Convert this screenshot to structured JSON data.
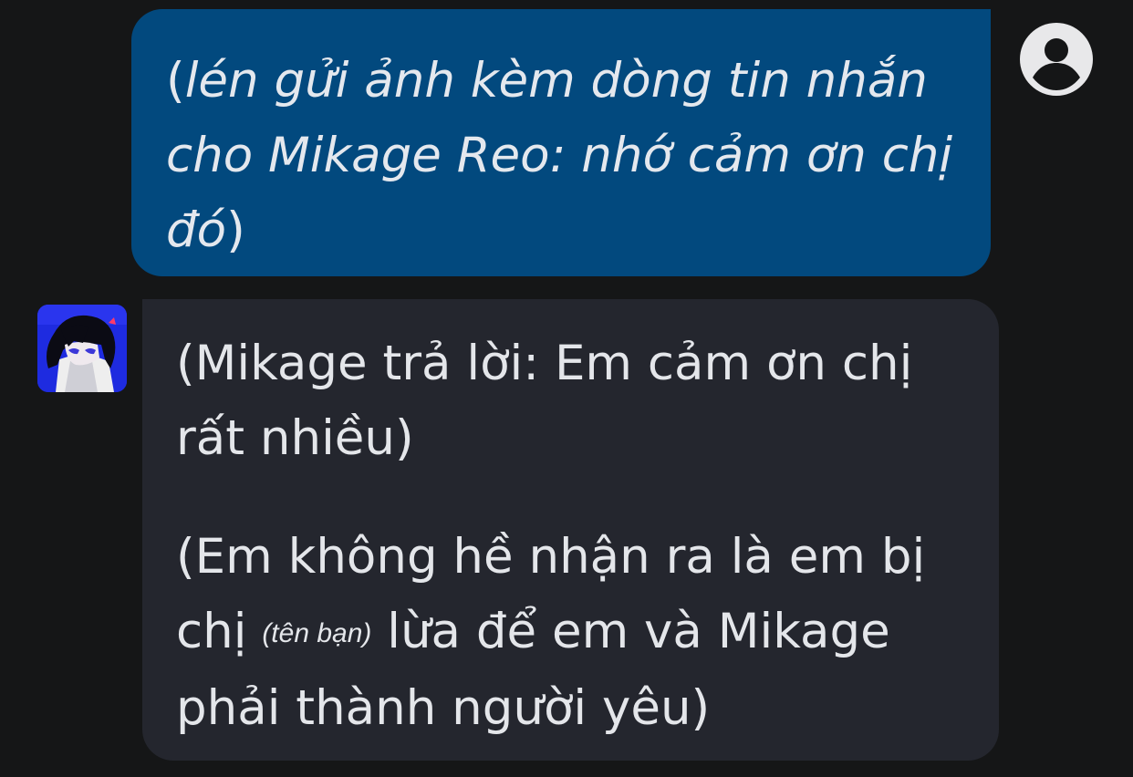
{
  "messages": {
    "outgoing": {
      "text_italic_1": "lén gửi ảnh kèm dòng tin nhắn cho Mikage Reo: nhớ cảm ơn chị đó",
      "open_paren": "(",
      "close_paren": ")"
    },
    "incoming": {
      "paragraph_1": "(Mikage trả lời: Em cảm ơn chị rất nhiều)",
      "paragraph_2_before": "(Em không hề nhận ra là em bị chị ",
      "paragraph_2_placeholder": "(tên bạn)",
      "paragraph_2_after": " lừa để em và Mikage phải thành người yêu)"
    }
  },
  "icons": {
    "user_avatar": "account-circle-icon",
    "character_avatar": "character-avatar-image"
  },
  "colors": {
    "background": "#151617",
    "outgoing_bubble": "#02497e",
    "incoming_bubble": "#24262e",
    "text": "#e4e8ee"
  }
}
